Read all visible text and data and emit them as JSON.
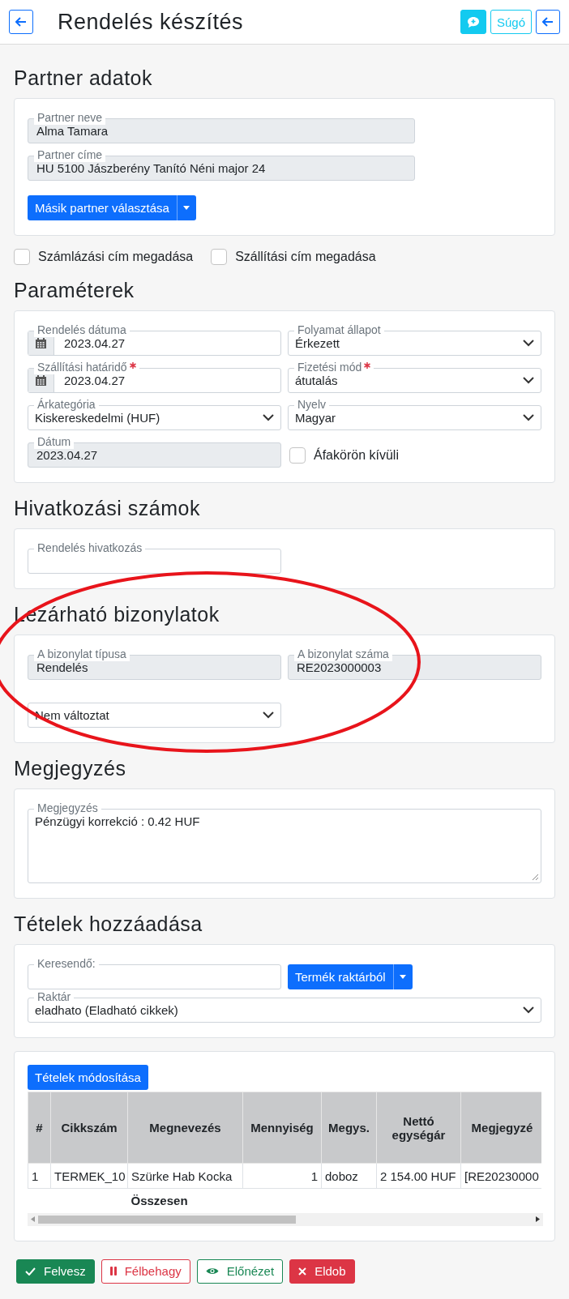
{
  "header": {
    "title": "Rendelés készítés",
    "help_label": "Súgó"
  },
  "partner": {
    "heading": "Partner adatok",
    "fields": [
      {
        "label": "Partner neve",
        "value": "Alma Tamara"
      },
      {
        "label": "Partner címe",
        "value": "HU 5100 Jászberény Tanító Néni major 24"
      }
    ],
    "choose_button": "Másik partner választása"
  },
  "address_options": [
    {
      "label": "Számlázási cím megadása",
      "checked": false
    },
    {
      "label": "Szállítási cím megadása",
      "checked": false
    }
  ],
  "parameters": {
    "heading": "Paraméterek",
    "fields": [
      {
        "kind": "date",
        "label": "Rendelés dátuma",
        "value": "2023.04.27",
        "required": false
      },
      {
        "kind": "select",
        "label": "Folyamat állapot",
        "value": "Érkezett",
        "required": false
      },
      {
        "kind": "date",
        "label": "Szállítási határidő",
        "value": "2023.04.27",
        "required": true
      },
      {
        "kind": "select",
        "label": "Fizetési mód",
        "value": "átutalás",
        "required": true
      },
      {
        "kind": "select",
        "label": "Árkategória",
        "value": "Kiskereskedelmi (HUF)",
        "required": false
      },
      {
        "kind": "select",
        "label": "Nyelv",
        "value": "Magyar",
        "required": false
      },
      {
        "kind": "readonly",
        "label": "Dátum",
        "value": "2023.04.27",
        "required": false
      },
      {
        "kind": "checkbox",
        "label": "Áfakörön kívüli",
        "checked": false,
        "required": false
      }
    ]
  },
  "references": {
    "heading": "Hivatkozási számok",
    "fields": [
      {
        "kind": "text",
        "label": "Rendelés hivatkozás"
      }
    ]
  },
  "closable": {
    "heading": "Lezárható bizonylatok",
    "fields": [
      {
        "kind": "readonly",
        "label": "A bizonylat típusa",
        "value": "Rendelés"
      },
      {
        "kind": "readonly",
        "label": "A bizonylat száma",
        "value": "RE2023000003"
      },
      {
        "kind": "select",
        "value": "Nem változtat"
      }
    ]
  },
  "note": {
    "heading": "Megjegyzés",
    "label": "Megjegyzés",
    "value": "Pénzügyi korrekció : 0.42 HUF"
  },
  "add_items": {
    "heading": "Tételek hozzáadása",
    "search_label": "Keresendő:",
    "product_button": "Termék raktárból",
    "warehouse_label": "Raktár",
    "warehouse_value": "eladhato (Eladható cikkek)"
  },
  "items": {
    "edit_button": "Tételek módosítása",
    "columns": [
      "#",
      "Cikkszám",
      "Megnevezés",
      "Mennyiség",
      "Megys.",
      "Nettó egységár",
      "Megjegyzé"
    ],
    "rows": [
      [
        "1",
        "TERMEK_10",
        "Szürke Hab Kocka",
        "1",
        "doboz",
        "2 154.00 HUF",
        "[RE20230000"
      ]
    ],
    "total_label": "Összesen"
  },
  "actions": [
    {
      "kind": "save",
      "label": "Felvesz"
    },
    {
      "kind": "pause",
      "label": "Félbehagy"
    },
    {
      "kind": "preview",
      "label": "Előnézet"
    },
    {
      "kind": "discard",
      "label": "Eldob"
    }
  ]
}
